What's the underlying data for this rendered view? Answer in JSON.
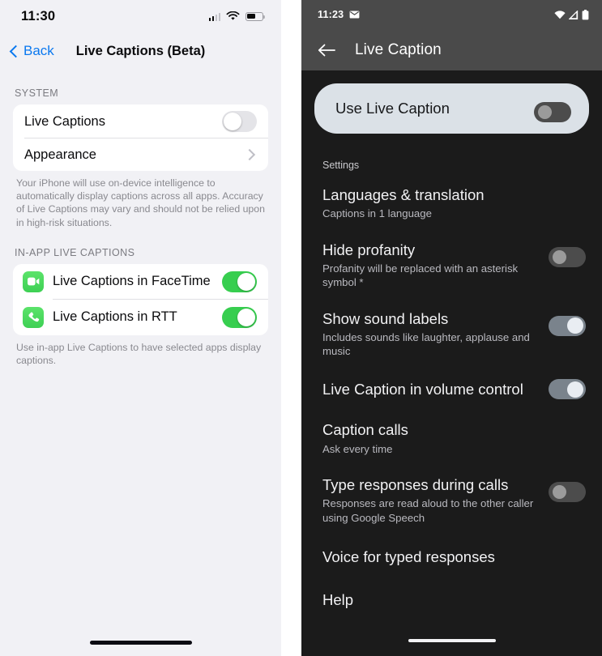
{
  "ios": {
    "status": {
      "time": "11:30",
      "cellular_icon": "cellular-signal-icon",
      "wifi_icon": "wifi-icon",
      "battery_icon": "battery-icon"
    },
    "nav": {
      "back_label": "Back",
      "title": "Live Captions (Beta)"
    },
    "sections": [
      {
        "header": "SYSTEM",
        "rows": [
          {
            "label": "Live Captions",
            "control": "toggle",
            "value": "off"
          },
          {
            "label": "Appearance",
            "control": "chevron"
          }
        ],
        "footnote": "Your iPhone will use on-device intelligence to automatically display captions across all apps. Accuracy of Live Captions may vary and should not be relied upon in high-risk situations."
      },
      {
        "header": "IN-APP LIVE CAPTIONS",
        "rows": [
          {
            "label": "Live Captions in FaceTime",
            "icon": "facetime-video-icon",
            "control": "toggle",
            "value": "on"
          },
          {
            "label": "Live Captions in RTT",
            "icon": "phone-handset-icon",
            "control": "toggle",
            "value": "on"
          }
        ],
        "footnote": "Use in-app Live Captions to have selected apps display captions."
      }
    ],
    "colors": {
      "accent": "#0a78ef",
      "toggle_on": "#37ce4f",
      "background": "#f1f1f5",
      "card": "#ffffff"
    }
  },
  "android": {
    "status": {
      "time": "11:23",
      "mail_icon": "envelope-icon",
      "wifi_icon": "wifi-icon",
      "signal_icon": "signal-triangle-icon",
      "battery_icon": "battery-icon"
    },
    "nav": {
      "back_icon": "arrow-left-icon",
      "title": "Live Caption"
    },
    "use_card": {
      "label": "Use Live Caption",
      "control": "toggle",
      "value": "off"
    },
    "section_header": "Settings",
    "rows": [
      {
        "title": "Languages & translation",
        "subtitle": "Captions in 1 language",
        "control": "none"
      },
      {
        "title": "Hide profanity",
        "subtitle": "Profanity will be replaced with an asterisk symbol *",
        "control": "toggle",
        "value": "off"
      },
      {
        "title": "Show sound labels",
        "subtitle": "Includes sounds like laughter, applause and music",
        "control": "toggle",
        "value": "on"
      },
      {
        "title": "Live Caption in volume control",
        "subtitle": "",
        "control": "toggle",
        "value": "on"
      },
      {
        "title": "Caption calls",
        "subtitle": "Ask every time",
        "control": "none"
      },
      {
        "title": "Type responses during calls",
        "subtitle": "Responses are read aloud to the other caller using Google Speech",
        "control": "toggle",
        "value": "off"
      },
      {
        "title": "Voice for typed responses",
        "subtitle": "",
        "control": "none"
      },
      {
        "title": "Help",
        "subtitle": "",
        "control": "none"
      }
    ],
    "colors": {
      "background": "#1b1b1b",
      "status_bar": "#4a4a4a",
      "card": "#dbe1e7",
      "toggle_on_track": "#7a838c"
    }
  }
}
